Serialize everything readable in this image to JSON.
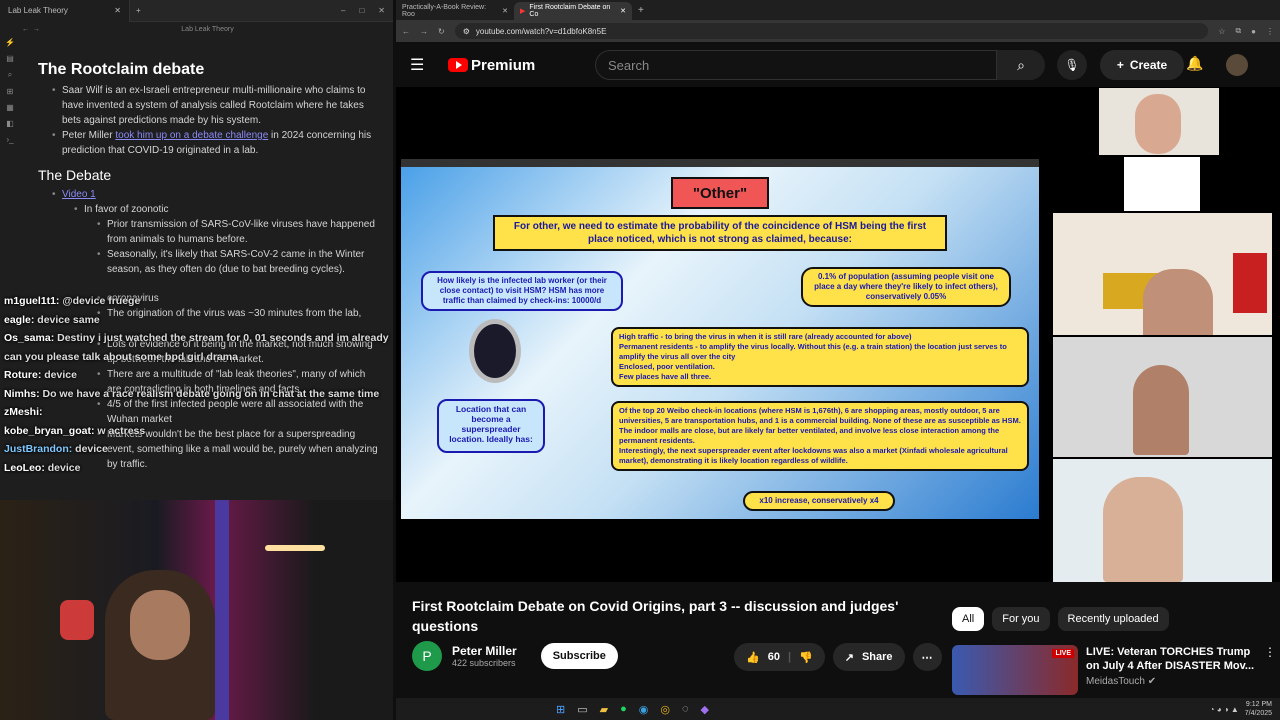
{
  "obsidian": {
    "tab_title": "Lab Leak Theory",
    "subtitle": "Lab Leak Theory",
    "h1": "The Rootclaim debate",
    "intro": [
      "Saar Wilf is an ex-Israeli entrepreneur multi-millionaire who claims to have invented a system of analysis called Rootclaim where he takes bets against predictions made by his system."
    ],
    "intro2_prefix": "Peter Miller ",
    "intro2_link": "took him up on a debate challenge",
    "intro2_suffix": " in 2024 concerning his prediction that COVID-19 originated in a lab.",
    "h2": "The Debate",
    "video_link": "Video 1",
    "zoonotic": "In favor of zoonotic",
    "points": [
      "Prior transmission of SARS-CoV-like viruses have happened from animals to humans before.",
      "Seasonally, it's likely that SARS-CoV-2 came in the Winter season, as they often do (due to bat breeding cycles).",
      "coronavirus",
      "The origination of the virus was ~30 minutes from the lab,",
      "Lots of evidence of it being in the market, not much showing up between the lab and the market.",
      "There are a multitude of \"lab leak theories\", many of which are contradicting in both timelines and facts",
      "4/5 of the first infected people were all associated with the Wuhan market",
      "Markets wouldn't be the best place for a superspreading event, something like a mall would be, purely when analyzing by traffic."
    ]
  },
  "chat": [
    {
      "user": "m1guel1t1:",
      "color": "#ffffff",
      "msg": "@device fruege"
    },
    {
      "user": "eagle:",
      "color": "#ffffff",
      "msg": "device same"
    },
    {
      "user": "Os_sama:",
      "color": "#ffffff",
      "msg": "Destiny i just watched the stream for 0, 01 seconds and im already   can you please talk about some bpd girl drama"
    },
    {
      "user": "Roture:",
      "color": "#ffffff",
      "msg": "device"
    },
    {
      "user": "Nimhs:",
      "color": "#ffffff",
      "msg": "Do we have a race realism debate going on in chat at the same time"
    },
    {
      "user": "zMeshi:",
      "color": "#ffffff",
      "msg": ""
    },
    {
      "user": "kobe_bryan_goat:",
      "color": "#ffffff",
      "msg": "w   actress"
    },
    {
      "user": "JustBrandon:",
      "color": "#7ec8ff",
      "msg": "device"
    },
    {
      "user": "LeoLeo:",
      "color": "#ffffff",
      "msg": "device"
    }
  ],
  "browser": {
    "tabs": [
      "Practically-A-Book Review: Roo",
      "First Rootclaim Debate on Co"
    ],
    "url": "youtube.com/watch?v=d1dbfoK8n5E"
  },
  "youtube": {
    "logo": "Premium",
    "search_placeholder": "Search",
    "create": "Create",
    "video_title": "First Rootclaim Debate on Covid Origins, part 3 -- discussion and judges' questions",
    "channel": "Peter Miller",
    "channel_initial": "P",
    "subscribers": "422 subscribers",
    "subscribe": "Subscribe",
    "likes": "60",
    "share": "Share",
    "chips": [
      "All",
      "For you",
      "Recently uploaded"
    ],
    "rec_title": "LIVE: Veteran TORCHES Trump on July 4 After DISASTER Mov...",
    "rec_channel": "MeidasTouch",
    "rec_badge": "LIVE"
  },
  "slide": {
    "label": "\"Other\"",
    "header": "For other, we need to estimate the probability of the coincidence of HSM being the first place noticed, which is not strong as claimed, because:",
    "box_left": "How likely is the infected lab worker (or their close contact) to visit HSM? HSM has more traffic than claimed by check-ins: 10000/d",
    "box_right": "0.1% of population (assuming people visit one place a day where they're likely to infect others), conservatively 0.05%",
    "box_mid": [
      "High traffic - to bring the virus in when it is still rare (already accounted for above)",
      "Permanent residents - to amplify the virus locally. Without this (e.g. a train station) the location just serves to amplify the virus all over the city",
      "Enclosed, poor ventilation.",
      "Few places have all three."
    ],
    "box_loc": "Location that can become a superspreader location. Ideally has:",
    "box_weibo": [
      "Of the top 20 Weibo check-in locations (where HSM is 1,676th), 6 are shopping areas, mostly outdoor, 5 are universities, 5 are transportation hubs, and 1 is a commercial building. None of these are as susceptible as HSM. The indoor malls are close, but are likely far better ventilated, and involve less close interaction among the permanent residents.",
      "Interestingly, the next superspreader event after lockdowns was also a market (Xinfadi wholesale agricultural market), demonstrating it is likely location regardless of wildlife."
    ],
    "box_bottom": "x10 increase, conservatively x4"
  },
  "taskbar": {
    "time": "9:12 PM",
    "date": "7/4/2025"
  }
}
